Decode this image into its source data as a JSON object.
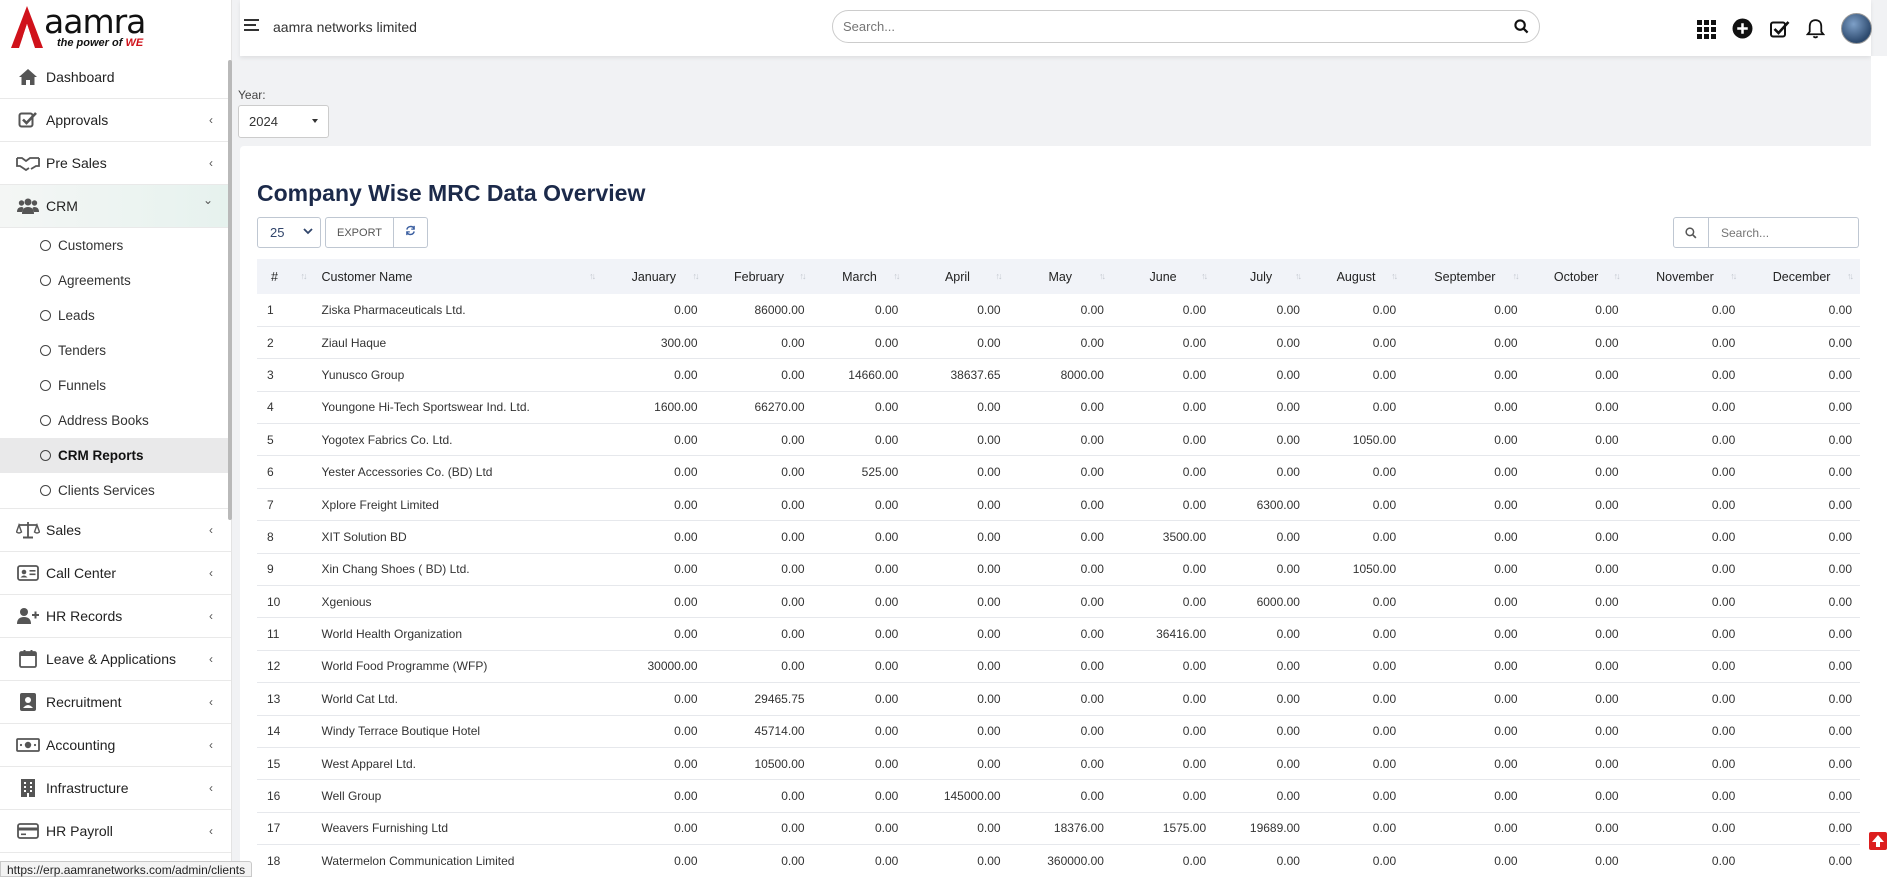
{
  "brand": {
    "logo_text": "aamra",
    "tagline_prefix": "the power of",
    "tagline_accent": "WE"
  },
  "sidebar": {
    "items": [
      {
        "label": "Dashboard",
        "icon": "home-icon",
        "arrow": ""
      },
      {
        "label": "Approvals",
        "icon": "checkbox-icon",
        "arrow": "‹"
      },
      {
        "label": "Pre Sales",
        "icon": "handshake-icon",
        "arrow": "‹"
      },
      {
        "label": "CRM",
        "icon": "users-icon",
        "arrow": "⌄",
        "active": true,
        "children": [
          {
            "label": "Customers"
          },
          {
            "label": "Agreements"
          },
          {
            "label": "Leads"
          },
          {
            "label": "Tenders"
          },
          {
            "label": "Funnels"
          },
          {
            "label": "Address Books"
          },
          {
            "label": "CRM Reports",
            "active": true
          },
          {
            "label": "Clients Services"
          }
        ]
      },
      {
        "label": "Sales",
        "icon": "scale-icon",
        "arrow": "‹"
      },
      {
        "label": "Call Center",
        "icon": "id-card-icon",
        "arrow": "‹"
      },
      {
        "label": "HR Records",
        "icon": "user-plus-icon",
        "arrow": "‹"
      },
      {
        "label": "Leave & Applications",
        "icon": "calendar-icon",
        "arrow": "‹"
      },
      {
        "label": "Recruitment",
        "icon": "portrait-icon",
        "arrow": "‹"
      },
      {
        "label": "Accounting",
        "icon": "money-icon",
        "arrow": "‹"
      },
      {
        "label": "Infrastructure",
        "icon": "building-icon",
        "arrow": "‹"
      },
      {
        "label": "HR Payroll",
        "icon": "credit-card-icon",
        "arrow": "‹"
      }
    ]
  },
  "header": {
    "company": "aamra networks limited",
    "search_placeholder": "Search..."
  },
  "filters": {
    "year_label": "Year:",
    "year_value": "2024"
  },
  "report": {
    "title": "Company Wise MRC Data Overview",
    "page_length": "25",
    "export_label": "EXPORT",
    "search_placeholder": "Search...",
    "columns": [
      "#",
      "Customer Name",
      "January",
      "February",
      "March",
      "April",
      "May",
      "June",
      "July",
      "August",
      "September",
      "October",
      "November",
      "December"
    ],
    "rows": [
      [
        "1",
        "Ziska Pharmaceuticals Ltd.",
        "0.00",
        "86000.00",
        "0.00",
        "0.00",
        "0.00",
        "0.00",
        "0.00",
        "0.00",
        "0.00",
        "0.00",
        "0.00",
        "0.00"
      ],
      [
        "2",
        "Ziaul Haque",
        "300.00",
        "0.00",
        "0.00",
        "0.00",
        "0.00",
        "0.00",
        "0.00",
        "0.00",
        "0.00",
        "0.00",
        "0.00",
        "0.00"
      ],
      [
        "3",
        "Yunusco Group",
        "0.00",
        "0.00",
        "14660.00",
        "38637.65",
        "8000.00",
        "0.00",
        "0.00",
        "0.00",
        "0.00",
        "0.00",
        "0.00",
        "0.00"
      ],
      [
        "4",
        "Youngone Hi-Tech Sportswear Ind. Ltd.",
        "1600.00",
        "66270.00",
        "0.00",
        "0.00",
        "0.00",
        "0.00",
        "0.00",
        "0.00",
        "0.00",
        "0.00",
        "0.00",
        "0.00"
      ],
      [
        "5",
        "Yogotex Fabrics Co. Ltd.",
        "0.00",
        "0.00",
        "0.00",
        "0.00",
        "0.00",
        "0.00",
        "0.00",
        "1050.00",
        "0.00",
        "0.00",
        "0.00",
        "0.00"
      ],
      [
        "6",
        "Yester Accessories Co. (BD) Ltd",
        "0.00",
        "0.00",
        "525.00",
        "0.00",
        "0.00",
        "0.00",
        "0.00",
        "0.00",
        "0.00",
        "0.00",
        "0.00",
        "0.00"
      ],
      [
        "7",
        "Xplore Freight Limited",
        "0.00",
        "0.00",
        "0.00",
        "0.00",
        "0.00",
        "0.00",
        "6300.00",
        "0.00",
        "0.00",
        "0.00",
        "0.00",
        "0.00"
      ],
      [
        "8",
        "XIT Solution BD",
        "0.00",
        "0.00",
        "0.00",
        "0.00",
        "0.00",
        "3500.00",
        "0.00",
        "0.00",
        "0.00",
        "0.00",
        "0.00",
        "0.00"
      ],
      [
        "9",
        "Xin Chang Shoes ( BD) Ltd.",
        "0.00",
        "0.00",
        "0.00",
        "0.00",
        "0.00",
        "0.00",
        "0.00",
        "1050.00",
        "0.00",
        "0.00",
        "0.00",
        "0.00"
      ],
      [
        "10",
        "Xgenious",
        "0.00",
        "0.00",
        "0.00",
        "0.00",
        "0.00",
        "0.00",
        "6000.00",
        "0.00",
        "0.00",
        "0.00",
        "0.00",
        "0.00"
      ],
      [
        "11",
        "World Health Organization",
        "0.00",
        "0.00",
        "0.00",
        "0.00",
        "0.00",
        "36416.00",
        "0.00",
        "0.00",
        "0.00",
        "0.00",
        "0.00",
        "0.00"
      ],
      [
        "12",
        "World Food Programme (WFP)",
        "30000.00",
        "0.00",
        "0.00",
        "0.00",
        "0.00",
        "0.00",
        "0.00",
        "0.00",
        "0.00",
        "0.00",
        "0.00",
        "0.00"
      ],
      [
        "13",
        "World Cat Ltd.",
        "0.00",
        "29465.75",
        "0.00",
        "0.00",
        "0.00",
        "0.00",
        "0.00",
        "0.00",
        "0.00",
        "0.00",
        "0.00",
        "0.00"
      ],
      [
        "14",
        "Windy Terrace Boutique Hotel",
        "0.00",
        "45714.00",
        "0.00",
        "0.00",
        "0.00",
        "0.00",
        "0.00",
        "0.00",
        "0.00",
        "0.00",
        "0.00",
        "0.00"
      ],
      [
        "15",
        "West Apparel Ltd.",
        "0.00",
        "10500.00",
        "0.00",
        "0.00",
        "0.00",
        "0.00",
        "0.00",
        "0.00",
        "0.00",
        "0.00",
        "0.00",
        "0.00"
      ],
      [
        "16",
        "Well Group",
        "0.00",
        "0.00",
        "0.00",
        "145000.00",
        "0.00",
        "0.00",
        "0.00",
        "0.00",
        "0.00",
        "0.00",
        "0.00",
        "0.00"
      ],
      [
        "17",
        "Weavers Furnishing Ltd",
        "0.00",
        "0.00",
        "0.00",
        "0.00",
        "18376.00",
        "1575.00",
        "19689.00",
        "0.00",
        "0.00",
        "0.00",
        "0.00",
        "0.00"
      ],
      [
        "18",
        "Watermelon Communication Limited",
        "0.00",
        "0.00",
        "0.00",
        "0.00",
        "360000.00",
        "0.00",
        "0.00",
        "0.00",
        "0.00",
        "0.00",
        "0.00",
        "0.00"
      ]
    ]
  },
  "status_bar": {
    "url": "https://erp.aamranetworks.com/admin/clients"
  },
  "colors": {
    "brand_red": "#d0121b",
    "title_navy": "#1c2a4a",
    "table_header_bg": "#f1f3f8"
  }
}
